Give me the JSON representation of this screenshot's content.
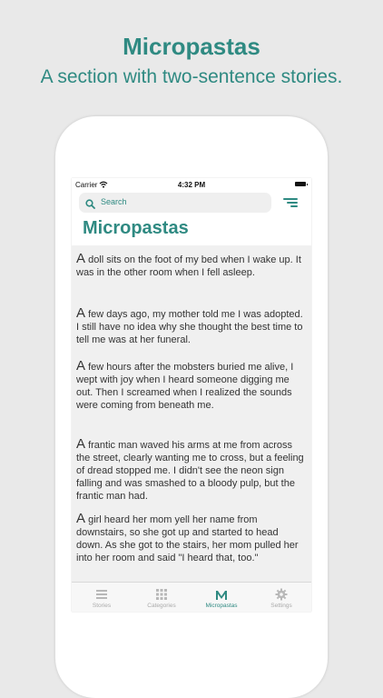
{
  "promo": {
    "title": "Micropastas",
    "subtitle": "A section with two-sentence stories."
  },
  "status_bar": {
    "carrier": "Carrier",
    "time": "4:32 PM"
  },
  "search": {
    "placeholder": "Search"
  },
  "nav": {
    "title": "Micropastas"
  },
  "stories": [
    {
      "first": "A",
      "rest": " doll sits on the foot of my bed when I wake up. It was in the other room when I fell asleep."
    },
    {
      "first": "A",
      "rest": " few days ago, my mother told me I was adopted. I still have no idea why she thought the best time to tell me was at her funeral."
    },
    {
      "first": "A",
      "rest": " few hours after the mobsters buried me alive, I wept with joy when I heard someone digging me out. Then I screamed when I realized the sounds were coming from beneath me."
    },
    {
      "first": "A",
      "rest": " frantic man waved his arms at me from across the street, clearly wanting me to cross, but a feeling of dread stopped me. I didn't see the neon sign falling and was smashed to a bloody pulp, but the frantic man had."
    },
    {
      "first": "A",
      "rest": " girl heard her mom yell her name from downstairs, so she got up and started to head down. As she got to the stairs, her mom pulled her into her room and said \"I heard that, too.\""
    }
  ],
  "tabs": [
    {
      "label": "Stories",
      "icon": "list-icon",
      "active": false
    },
    {
      "label": "Categories",
      "icon": "grid-icon",
      "active": false
    },
    {
      "label": "Micropastas",
      "icon": "m-letter-icon",
      "active": true
    },
    {
      "label": "Settings",
      "icon": "gear-icon",
      "active": false
    }
  ],
  "colors": {
    "accent": "#2f8a82",
    "background": "#e9e9e9",
    "content_bg": "#f0f0f0",
    "inactive": "#aaaaaa"
  }
}
